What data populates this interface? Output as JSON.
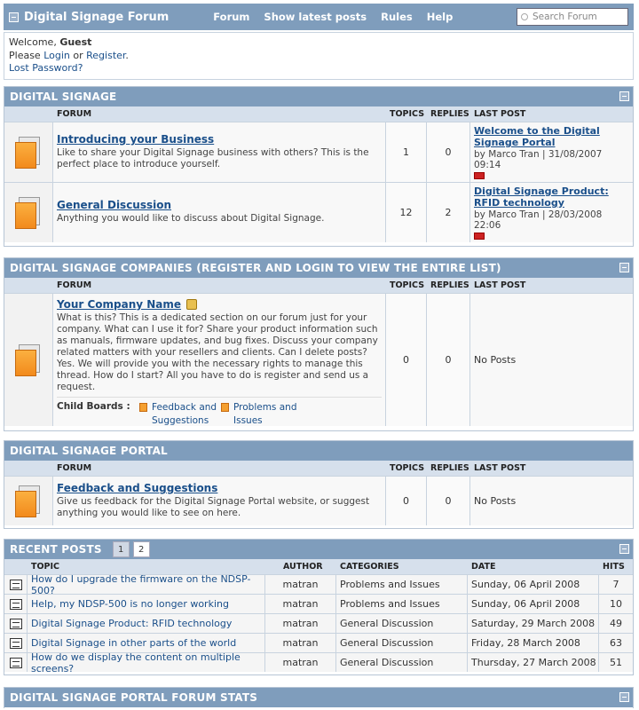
{
  "header": {
    "title": "Digital Signage Forum",
    "nav": [
      "Forum",
      "Show latest posts",
      "Rules",
      "Help"
    ],
    "search_placeholder": "Search Forum"
  },
  "welcome": {
    "greeting": "Welcome, ",
    "user": "Guest",
    "please": "Please ",
    "login": "Login",
    "or": " or ",
    "register": "Register",
    "period": ".",
    "lost_password": "Lost Password?"
  },
  "columns": {
    "forum": "FORUM",
    "topics": "TOPICS",
    "replies": "REPLIES",
    "last_post": "LAST POST"
  },
  "sections": [
    {
      "title": "DIGITAL SIGNAGE",
      "forums": [
        {
          "name": "Introducing your Business",
          "desc": "Like to share your Digital Signage business with others? This is the perfect place to introduce yourself.",
          "topics": "1",
          "replies": "0",
          "last_title": "Welcome to the Digital Signage Portal",
          "last_by": "by Marco Tran | 31/08/2007 09:14"
        },
        {
          "name": "General Discussion",
          "desc": "Anything you would like to discuss about Digital Signage.",
          "topics": "12",
          "replies": "2",
          "last_title": "Digital Signage Product: RFID technology",
          "last_by": "by Marco Tran | 28/03/2008 22:06"
        }
      ]
    },
    {
      "title": "DIGITAL SIGNAGE COMPANIES (REGISTER AND LOGIN TO VIEW THE ENTIRE LIST)",
      "forums": [
        {
          "name": "Your Company Name",
          "desc": "What is this? This is a dedicated section on our forum just for your company. What can I use it for? Share your product information such as manuals, firmware updates, and bug fixes. Discuss your company related matters with your resellers and clients. Can I delete posts? Yes. We will provide you with the necessary rights to manage this thread. How do I start? All you have to do is register and send us a request.",
          "topics": "0",
          "replies": "0",
          "last_none": "No Posts",
          "child_label": "Child Boards :",
          "child_boards": [
            "Feedback and Suggestions",
            "Problems and Issues"
          ]
        }
      ]
    },
    {
      "title": "DIGITAL SIGNAGE PORTAL",
      "forums": [
        {
          "name": "Feedback and Suggestions",
          "desc": "Give us feedback for the Digital Signage Portal website, or suggest anything you would like to see on here.",
          "topics": "0",
          "replies": "0",
          "last_none": "No Posts"
        }
      ]
    }
  ],
  "recent": {
    "title": "RECENT POSTS",
    "pages": [
      "1",
      "2"
    ],
    "columns": {
      "topic": "TOPIC",
      "author": "AUTHOR",
      "categories": "CATEGORIES",
      "date": "DATE",
      "hits": "HITS"
    },
    "rows": [
      {
        "topic": "How do I upgrade the firmware on the NDSP-500?",
        "author": "matran",
        "category": "Problems and Issues",
        "date": "Sunday, 06 April 2008",
        "hits": "7"
      },
      {
        "topic": "Help, my NDSP-500 is no longer working",
        "author": "matran",
        "category": "Problems and Issues",
        "date": "Sunday, 06 April 2008",
        "hits": "10"
      },
      {
        "topic": "Digital Signage Product: RFID technology",
        "author": "matran",
        "category": "General Discussion",
        "date": "Saturday, 29 March 2008",
        "hits": "49"
      },
      {
        "topic": "Digital Signage in other parts of the world",
        "author": "matran",
        "category": "General Discussion",
        "date": "Friday, 28 March 2008",
        "hits": "63"
      },
      {
        "topic": "How do we display the content on multiple screens?",
        "author": "matran",
        "category": "General Discussion",
        "date": "Thursday, 27 March 2008",
        "hits": "51"
      }
    ]
  },
  "stats": {
    "title": "DIGITAL SIGNAGE PORTAL FORUM STATS"
  }
}
